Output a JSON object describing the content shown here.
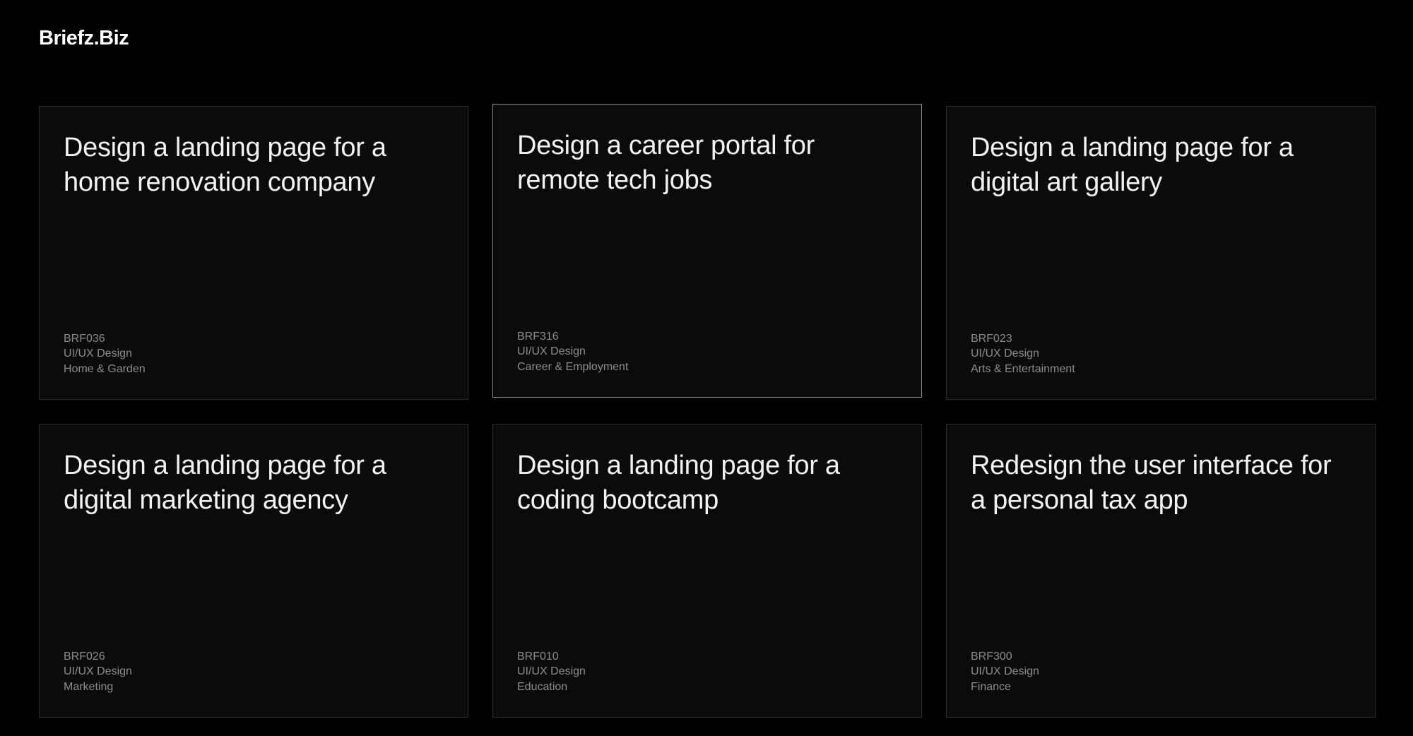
{
  "header": {
    "logo": "Briefz.Biz"
  },
  "cards": [
    {
      "title": "Design a landing page for a home renovation company",
      "code": "BRF036",
      "discipline": "UI/UX Design",
      "industry": "Home & Garden"
    },
    {
      "title": "Design a career portal for remote tech jobs",
      "code": "BRF316",
      "discipline": "UI/UX Design",
      "industry": "Career & Employment"
    },
    {
      "title": "Design a landing page for a digital art gallery",
      "code": "BRF023",
      "discipline": "UI/UX Design",
      "industry": "Arts & Entertainment"
    },
    {
      "title": "Design a landing page for a digital marketing agency",
      "code": "BRF026",
      "discipline": "UI/UX Design",
      "industry": "Marketing"
    },
    {
      "title": "Design a landing page for a coding bootcamp",
      "code": "BRF010",
      "discipline": "UI/UX Design",
      "industry": "Education"
    },
    {
      "title": "Redesign the user interface for a personal tax app",
      "code": "BRF300",
      "discipline": "UI/UX Design",
      "industry": "Finance"
    }
  ],
  "colors": {
    "background": "#000000",
    "card_background": "#0b0b0b",
    "card_border": "#2c2c2c",
    "card_border_hover": "#8a8a8a",
    "title_text": "#f2f2f2",
    "meta_text": "#8c8c8c"
  }
}
